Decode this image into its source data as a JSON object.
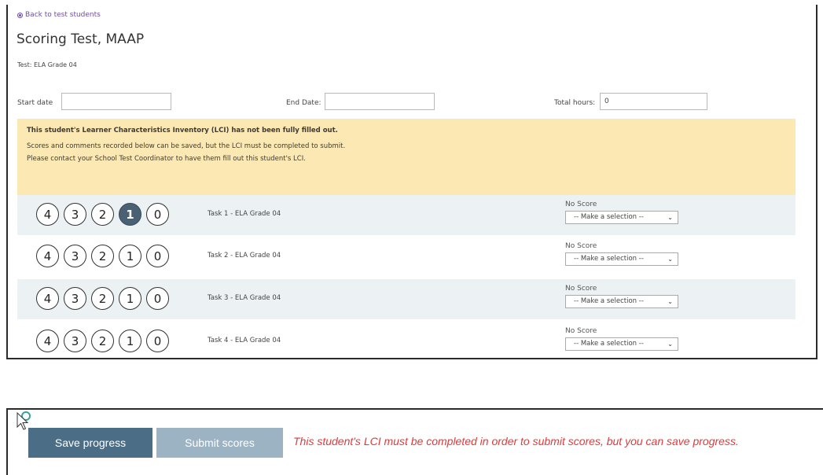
{
  "back_link": "Back to test students",
  "title": "Scoring Test, MAAP",
  "test_label": "Test: ELA Grade 04",
  "fields": {
    "start_date_label": "Start date",
    "start_date_value": "",
    "end_date_label": "End Date:",
    "end_date_value": "",
    "total_hours_label": "Total hours:",
    "total_hours_value": "0"
  },
  "alert": {
    "heading": "This student's Learner Characteristics Inventory (LCI) has not been fully filled out.",
    "line1": "Scores and comments recorded below can be saved, but the LCI must be completed to submit.",
    "line2": "Please contact your School Test Coordinator to have them fill out this student's LCI."
  },
  "score_options": [
    "4",
    "3",
    "2",
    "1",
    "0"
  ],
  "tasks": [
    {
      "label": "Task 1 - ELA Grade 04",
      "selected": "1",
      "no_score_label": "No Score",
      "select_value": "-- Make a selection --"
    },
    {
      "label": "Task 2 - ELA Grade 04",
      "selected": null,
      "no_score_label": "No Score",
      "select_value": "-- Make a selection --"
    },
    {
      "label": "Task 3 - ELA Grade 04",
      "selected": null,
      "no_score_label": "No Score",
      "select_value": "-- Make a selection --"
    },
    {
      "label": "Task 4 - ELA Grade 04",
      "selected": null,
      "no_score_label": "No Score",
      "select_value": "-- Make a selection --"
    }
  ],
  "buttons": {
    "save": "Save progress",
    "submit": "Submit scores"
  },
  "error_message": "This student's LCI must be completed in order to submit scores, but you can save progress.",
  "colors": {
    "selected_score": "#4a6173",
    "save_button": "#4c6d86",
    "submit_button_disabled": "#9cb3c4",
    "alert_bg": "#fce8b2",
    "error_text": "#e03a3a",
    "link": "#6b4fa0"
  }
}
